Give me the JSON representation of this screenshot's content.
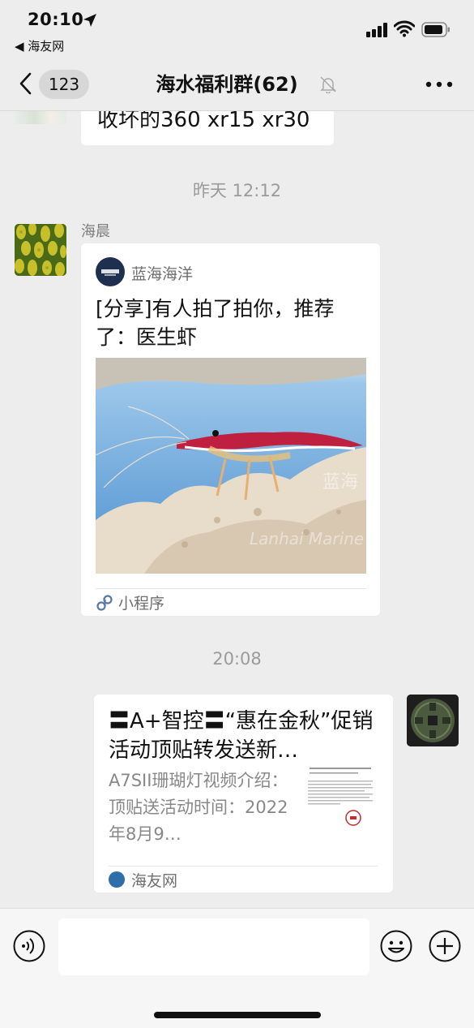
{
  "status": {
    "time": "20:10",
    "back_app": "◀ 海友网"
  },
  "nav": {
    "unread_count": "123",
    "title": "海水福利群(62)"
  },
  "previous_message": {
    "text": "收坏的360  xr15 xr30"
  },
  "timestamps": [
    "昨天 12:12",
    "20:08"
  ],
  "message1": {
    "sender": "海晨",
    "card": {
      "source": "蓝海海洋",
      "title": "[分享]有人拍了拍你，推荐了：医生虾",
      "footer_label": "小程序",
      "watermark": "Lanhai Marine"
    }
  },
  "message2": {
    "card": {
      "title": "〓A+智控〓“惠在金秋”促销活动顶贴转发送新…",
      "description": "A7SII珊瑚灯视频介绍：顶贴送活动时间：2022年8月9…",
      "source": "海友网"
    }
  },
  "colors": {
    "background": "#ededed",
    "bubble": "#ffffff",
    "muted_text": "#7c7c7c"
  }
}
